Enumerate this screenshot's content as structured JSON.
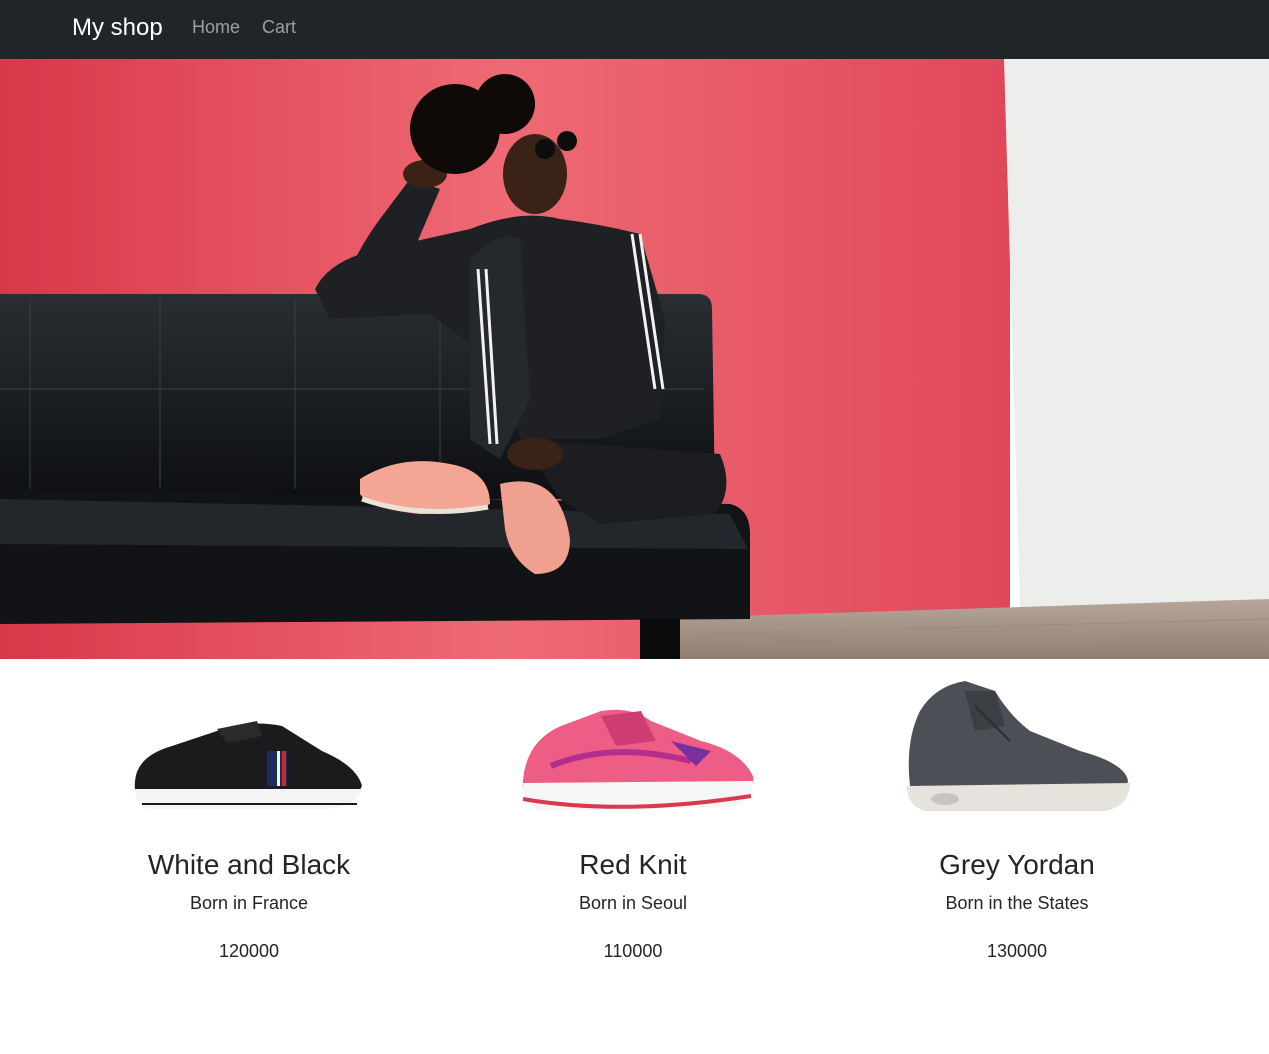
{
  "navbar": {
    "brand": "My shop",
    "links": [
      {
        "label": "Home"
      },
      {
        "label": "Cart"
      }
    ]
  },
  "hero": {
    "image": "woman-sitting-on-black-leather-sofa-icon",
    "colors": {
      "wall": "#e8505f",
      "sofa": "#15181c",
      "floor": "#a8968a",
      "side_wall": "#eceeec"
    }
  },
  "products": [
    {
      "title": "White and Black",
      "origin": "Born in France",
      "price": "120000",
      "image": "black-sneaker-icon"
    },
    {
      "title": "Red Knit",
      "origin": "Born in Seoul",
      "price": "110000",
      "image": "pink-running-shoe-icon"
    },
    {
      "title": "Grey Yordan",
      "origin": "Born in the States",
      "price": "130000",
      "image": "grey-high-top-sneaker-icon"
    }
  ]
}
